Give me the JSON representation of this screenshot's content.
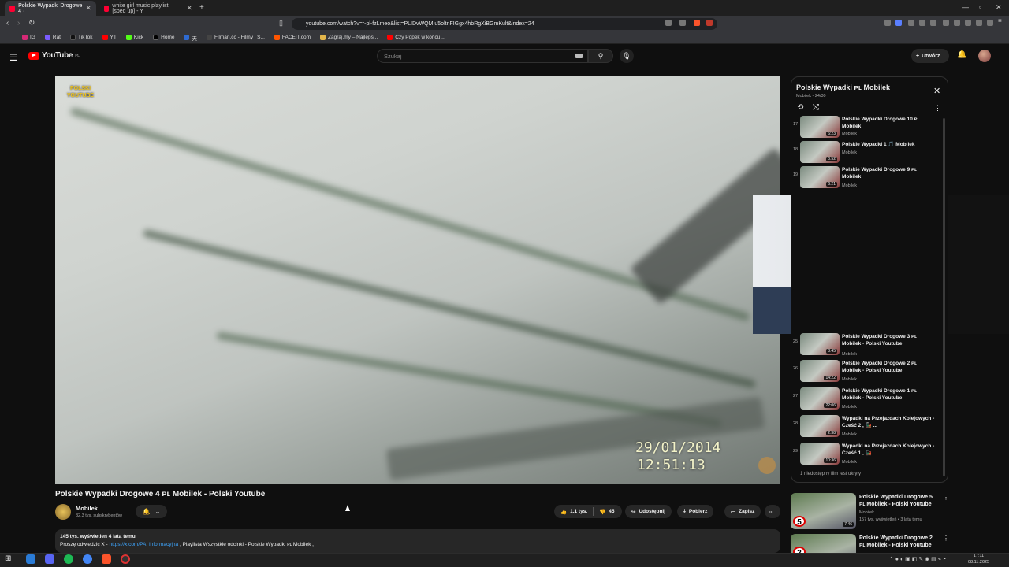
{
  "browser": {
    "tabs": [
      {
        "title": "Polskie Wypadki Drogowe 4 ·"
      },
      {
        "title": "white girl music playlist [sped up] - Y"
      }
    ],
    "url": "youtube.com/watch?v=r-pl-fzLmeo&list=PLIDvWQMIu5oltnFIGgx4hbRgXiBGmKult&index=24",
    "bookmarks": [
      "IG",
      "Rat",
      "TikTok",
      "YT",
      "Kick",
      "Home",
      "天",
      "Filman.cc - Filmy i S...",
      "FACEIT.com",
      "Zagraj.my – Najleps...",
      "Czy Popek w końcu..."
    ],
    "accent": "#ff0033"
  },
  "youtube": {
    "logo_text": "YouTube",
    "logo_region": "PL",
    "search_placeholder": "Szukaj",
    "create_label": "Utwórz"
  },
  "video": {
    "channel_watermark": "POLSKI YOUTUBE",
    "timestamp_date": "29/01/2014",
    "timestamp_time": "12:51:13",
    "title": "Polskie Wypadki Drogowe 4 ᴘʟ Mobilek - Polski Youtube",
    "channel": "Mobilek",
    "subscribers": "32,3 tys. subskrybentów",
    "likes": "1,1 tys.",
    "dislikes": "45",
    "share_label": "Udostępnij",
    "download_label": "Pobierz",
    "save_label": "Zapisz",
    "views_line": "145 tys. wyświetleń  4 lata temu",
    "desc_prefix": "Proszę odwiedzić X - ",
    "desc_link": "https://x.com/PA_Informacyjna",
    "desc_middle": " ,  Playlista Wszystkie odcinki - ",
    "desc_playlist": " Polskie Wypadki ᴘʟ Mobilek ,"
  },
  "playlist": {
    "title": "Polskie Wypadki ᴘʟ Mobilek",
    "subtitle": "Mobilek - 24/30",
    "unavailable": "1 niedostępny film jest ukryty",
    "items": [
      {
        "num": "17",
        "title": "Polskie Wypadki Drogowe 10 ᴘʟ Mobilek",
        "channel": "Mobilek",
        "duration": "6:23"
      },
      {
        "num": "18",
        "title": "Polskie Wypadki 1 🎵 Mobilek",
        "channel": "Mobilek",
        "duration": "0:52"
      },
      {
        "num": "19",
        "title": "Polskie Wypadki Drogowe 9 ᴘʟ Mobilek",
        "channel": "Mobilek",
        "duration": "6:21"
      },
      {
        "num": "25",
        "title": "Polskie Wypadki Drogowe 3 ᴘʟ Mobilek - Polski Youtube",
        "channel": "Mobilek",
        "duration": "8:45"
      },
      {
        "num": "26",
        "title": "Polskie Wypadki Drogowe 2 ᴘʟ Mobilek - Polski Youtube",
        "channel": "Mobilek",
        "duration": "14:22"
      },
      {
        "num": "27",
        "title": "Polskie Wypadki Drogowe 1 ᴘʟ Mobilek - Polski Youtube",
        "channel": "Mobilek",
        "duration": "22:06"
      },
      {
        "num": "28",
        "title": "Wypadki na Przejazdach Kolejowych - Cześć 2 , 🚂 ...",
        "channel": "Mobilek",
        "duration": "2:38"
      },
      {
        "num": "29",
        "title": "Wypadki na Przejazdach Kolejowych - Cześć 1 , 🚂 ...",
        "channel": "Mobilek",
        "duration": "10:36"
      }
    ]
  },
  "recommendations": [
    {
      "title": "Polskie Wypadki Drogowe  5  ᴘʟ Mobilek - Polski Youtube",
      "channel": "Mobilek",
      "meta": "157 tys. wyświetleń • 3 lata temu",
      "duration": "7:46",
      "badge": "5"
    },
    {
      "title": "Polskie Wypadki Drogowe  2  ᴘʟ Mobilek - Polski Youtube",
      "channel": "",
      "meta": "",
      "duration": "",
      "badge": "2"
    }
  ],
  "taskbar": {
    "time": "17:11",
    "date": "08.11.2025"
  }
}
